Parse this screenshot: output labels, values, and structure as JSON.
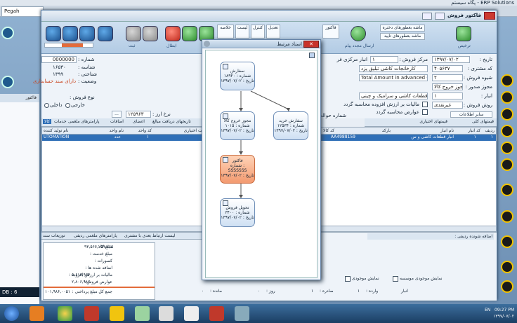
{
  "titlebar": {
    "text": "ERP Solutions - پگاه سیستم"
  },
  "browser_tab": {
    "label": "Pegah"
  },
  "window": {
    "title": "فاکتور فروش"
  },
  "ribbon": {
    "labels": [
      "ارسال مجدد پیام",
      "ترخیص",
      "ثبت",
      "ثبت",
      "ابطال",
      "بستن",
      "پرینت",
      "اعلام"
    ],
    "small": [
      "ماشه بعطورهای دختره",
      "ترحیص",
      "ماشه بعطورهای تایید"
    ],
    "field_left": "حسابداری"
  },
  "form": {
    "date_label": "تاریخ :",
    "date_value": "۱۳۹۷/۰۷/۰۲",
    "sales_center_label": "مرکز فروش :",
    "sales_center_value": "۱",
    "warehouse_label": "انبار مرکزی فر",
    "customer_label": "کد مشتری :",
    "customer_code": "۴۰۵۶۳۷",
    "customer_name": "کارخانجات کاشی تبلیق یزد",
    "method_label": "شیوه فروش :",
    "method_value": "۲",
    "method_name": "Total Amount in advanced Cash",
    "issue_label": "مجوز صدور :",
    "issue_value": "مجوز خروج کالا",
    "store_label": "انبار :",
    "store_value": "۱",
    "store_name": "انبار قطعات کاشی و سرامیک و چینی",
    "pay_label": "روش فروش :",
    "pay_value": "غیرنقدی",
    "vat_label": "مالیات بر ارزش افزوده محاسبه گردد",
    "duty_label": "عوارض محاسبه گردد",
    "number_label": "شماره :",
    "number_value": "0000000",
    "serial_label": "شناسه :",
    "serial_value": "۱۶۵۳۰",
    "date2_label": "شناختی :",
    "date2_value": "۱۳۹۹",
    "status_label": "وضعیت :",
    "status_value": "دارای سند حسابداری",
    "type_label": "نوع فروش :",
    "radio_a": "داخلی",
    "radio_b": "خارجی",
    "rate_label": "نرخ ارز :",
    "rate_value": "۱۲۵۹۶۳",
    "info_btn": "سایر اطلاعات",
    "order_number": "شماره حواله"
  },
  "tabs_left": [
    "اعلام",
    "خدمات",
    "پارامترهای ملغمی",
    "اعضای",
    "اضافات",
    "تاریخهای دریافت مبالغ",
    "کالا"
  ],
  "tabs_right": [
    "قیمتهای کلی",
    "قیمتهای اختیاری"
  ],
  "grid": {
    "headers": [
      "ردیف",
      "کد انبار",
      "نام انبار",
      "بارکد",
      "کد کالا",
      "قیمت اختیاری",
      "کد واحد",
      "نام واحد",
      "نام تولید کننده"
    ],
    "row": [
      "۱",
      "۱",
      "انبار قطعات کاشی و س",
      "",
      "AA4988159",
      "",
      "۱",
      "عدد",
      "UTOMATION"
    ]
  },
  "bottom": {
    "section_left": "لیست ارتباط بعدی با مشتری",
    "section_left2": "پارامترهای ملغمی ردیفی",
    "section_left3": "توزیعات سند",
    "amount_label": "مبلغ کالا :",
    "amount_value": "۹۳,۵۶۶,۰۵۹,۷۶۵",
    "service_label": "مبلغ خدمت :",
    "discount_label": "کسورات :",
    "added_label": "اضافه شده ها :",
    "vat_label": "مالیات بر ارزش افزوده :",
    "vat_value": "۵,۶۱۳,۹۶۴",
    "duty_label": "عوارض فروش :",
    "duty_value": "۲,۸۰۶,۹۸۲",
    "total_label": "جمع کل مبلغ پرداختی :",
    "total_value": "۱۰۱,۹۸۶,۰۰۵۱",
    "right_label": "اضافه شونده ردیفی :",
    "mojodi_a": "نمایش موجودی موسسه",
    "mojodi_b": "نمایش موجودی",
    "store_label": "انبار",
    "sadere_label": "وارده :",
    "warede_label": "صادره :",
    "value_a": "۱",
    "value_b": "۱",
    "darsad": "مانده :",
    "darsad_val": "۰",
    "rooz": "روز :",
    "rooz_val": "۰"
  },
  "popup": {
    "title": "اسناد مرتبط",
    "nodes": [
      {
        "title": "سفارش",
        "line2": "شماره : ۱۸۹۲۰",
        "line3": "تاریخ : ۱۳۹۷/۰۷/۰۲"
      },
      {
        "title": "مجوز خروج کالا",
        "line2": "شماره : ۱۰۱۵",
        "line3": "تاریخ : ۱۳۹۷/۰۷/۰۲"
      },
      {
        "title": "سفارش خرید",
        "line2": "شماره : ۱۲۵۳۴",
        "line3": "تاریخ : ۱۳۹۷/۰۷/۰۲"
      },
      {
        "title": "فاکتور",
        "line2": "شماره :",
        "line3": "SSSSSSS",
        "line4": "تاریخ : ۱۳۹۷/۰۷/۰۲"
      },
      {
        "title": "تحویل فروش",
        "line2": "شماره : ۳۴۰۰",
        "line3": "تاریخ : ۱۳۹۷/۰۷/۰۲"
      }
    ]
  },
  "taskbar": {
    "time": "09:27 PM",
    "lang": "EN",
    "date": "۱۳۹۷/۰۷/۰۲"
  },
  "statusbar": {
    "db": "DB : 6"
  },
  "colors": {
    "accent": "#2f6fb7",
    "highlight_node": "#f39a70",
    "ribbon_bg": "#b2cbe4"
  }
}
